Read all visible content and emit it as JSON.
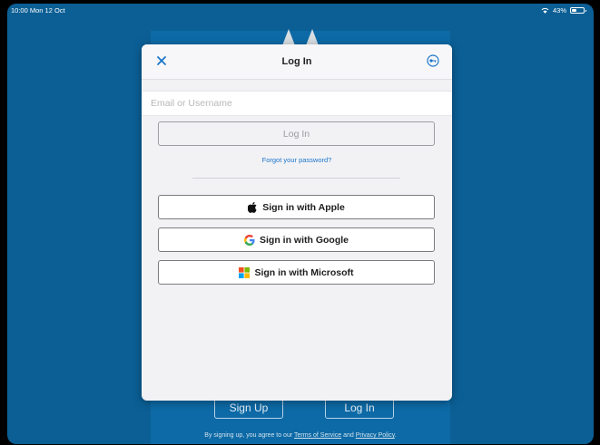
{
  "status_bar": {
    "time": "10:00  Mon 12 Oct",
    "battery": "43%",
    "battery_level": 0.43
  },
  "background": {
    "signup_label": "Sign Up",
    "login_label": "Log In",
    "legal_prefix": "By signing up, you agree to our ",
    "terms_label": "Terms of Service",
    "legal_and": " and ",
    "privacy_label": "Privacy Policy",
    "legal_suffix": "."
  },
  "modal": {
    "title": "Log In",
    "email_placeholder": "Email or Username",
    "email_value": "",
    "login_button": "Log In",
    "forgot_link": "Forgot your password?",
    "sso_buttons": [
      {
        "label": "Sign in with Apple",
        "icon": "apple-icon"
      },
      {
        "label": "Sign in with Google",
        "icon": "google-icon"
      },
      {
        "label": "Sign in with Microsoft",
        "icon": "microsoft-icon"
      }
    ]
  },
  "colors": {
    "background": "#0b5f95",
    "link": "#1a75c9",
    "accent": "#1a75c9"
  }
}
